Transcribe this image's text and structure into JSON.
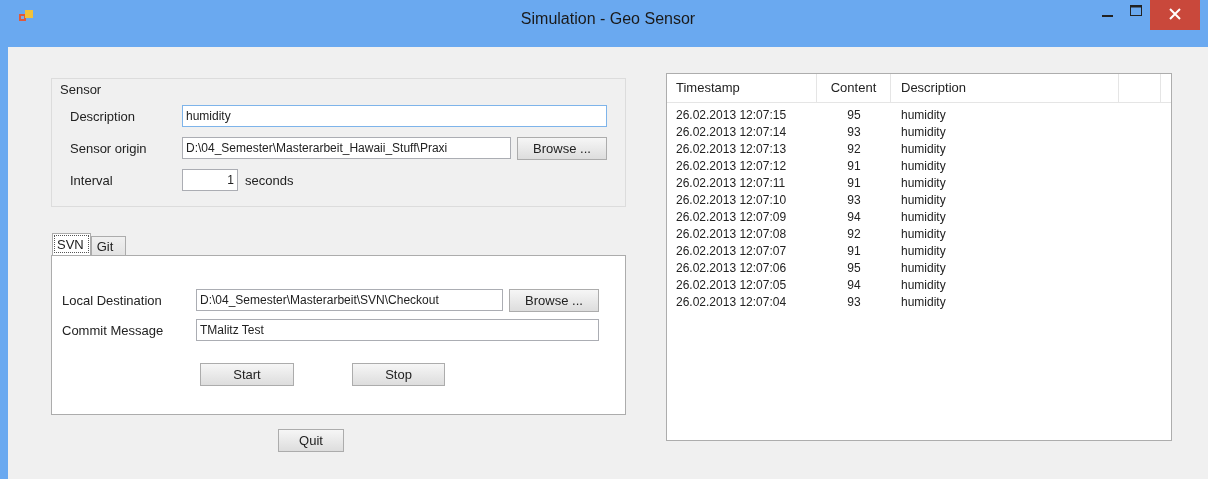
{
  "window": {
    "title": "Simulation - Geo Sensor"
  },
  "sensor": {
    "title": "Sensor",
    "description": {
      "label": "Description",
      "value": "humidity"
    },
    "origin": {
      "label": "Sensor origin",
      "value": "D:\\04_Semester\\Masterarbeit_Hawaii_Stuff\\Praxi",
      "button": "Browse ..."
    },
    "interval": {
      "label": "Interval",
      "value": "1",
      "unit": "seconds"
    }
  },
  "tabs": [
    {
      "label": "SVN",
      "selected": true
    },
    {
      "label": "Git",
      "selected": false
    }
  ],
  "svn": {
    "destination": {
      "label": "Local Destination",
      "value": "D:\\04_Semester\\Masterarbeit\\SVN\\Checkout",
      "button": "Browse ..."
    },
    "commit": {
      "label": "Commit Message",
      "value": "TMalitz Test"
    },
    "buttons": [
      "Start",
      "Stop"
    ]
  },
  "quit_button": "Quit",
  "table": {
    "columns": [
      "Timestamp",
      "Content",
      "Description"
    ],
    "rows": [
      [
        "26.02.2013 12:07:15",
        "95",
        "humidity"
      ],
      [
        "26.02.2013 12:07:14",
        "93",
        "humidity"
      ],
      [
        "26.02.2013 12:07:13",
        "92",
        "humidity"
      ],
      [
        "26.02.2013 12:07:12",
        "91",
        "humidity"
      ],
      [
        "26.02.2013 12:07:11",
        "91",
        "humidity"
      ],
      [
        "26.02.2013 12:07:10",
        "93",
        "humidity"
      ],
      [
        "26.02.2013 12:07:09",
        "94",
        "humidity"
      ],
      [
        "26.02.2013 12:07:08",
        "92",
        "humidity"
      ],
      [
        "26.02.2013 12:07:07",
        "91",
        "humidity"
      ],
      [
        "26.02.2013 12:07:06",
        "95",
        "humidity"
      ],
      [
        "26.02.2013 12:07:05",
        "94",
        "humidity"
      ],
      [
        "26.02.2013 12:07:04",
        "93",
        "humidity"
      ]
    ]
  }
}
